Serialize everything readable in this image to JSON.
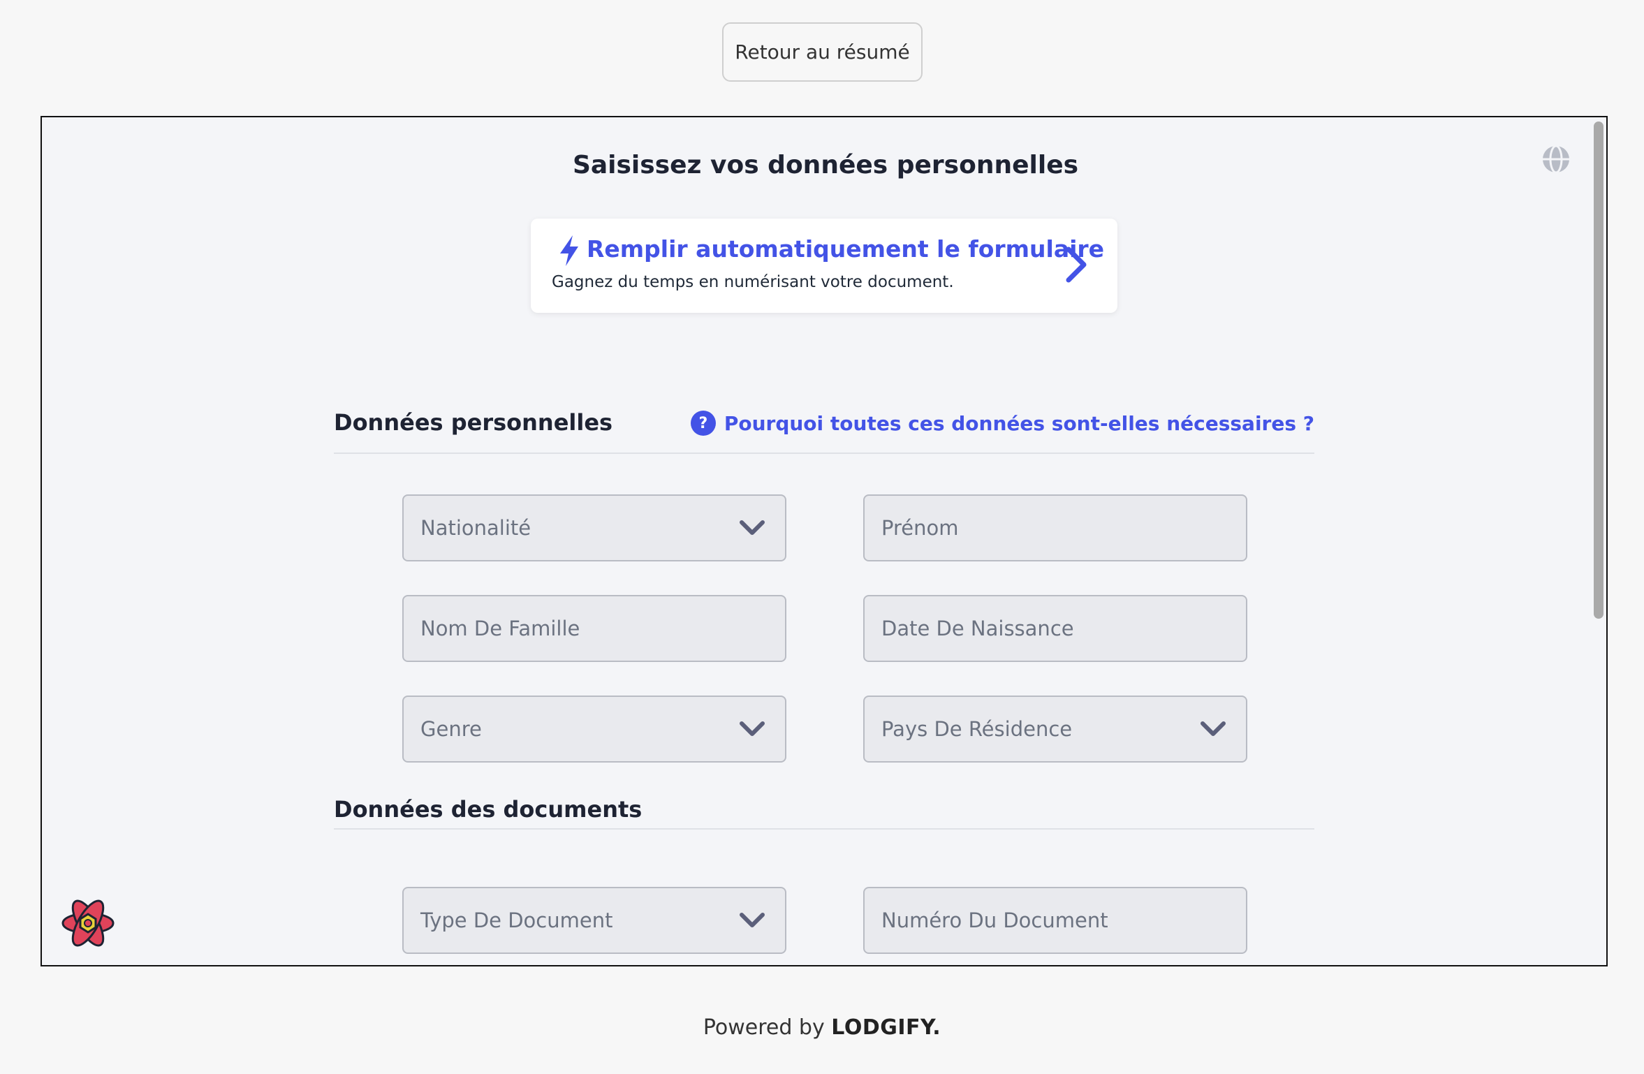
{
  "back_button": {
    "label": "Retour au résumé"
  },
  "form": {
    "title": "Saisissez vos données personnelles",
    "globe_icon": "globe-icon",
    "autofill": {
      "title": "Remplir automatiquement le formulaire",
      "subtitle": "Gagnez du temps en numérisant votre document.",
      "icon": "lightning-icon",
      "arrow_icon": "chevron-right-icon"
    },
    "personal_section": {
      "title": "Données personnelles",
      "help_link": "Pourquoi toutes ces données sont-elles nécessaires ?",
      "fields": {
        "nationality": "Nationalité",
        "first_name": "Prénom",
        "last_name": "Nom De Famille",
        "birth_date": "Date De Naissance",
        "gender": "Genre",
        "residence_country": "Pays De Résidence"
      }
    },
    "documents_section": {
      "title": "Données des documents",
      "fields": {
        "document_type": "Type De Document",
        "document_number": "Numéro Du Document"
      }
    }
  },
  "footer": {
    "powered_prefix": "Powered by",
    "brand": "LODGIFY."
  },
  "colors": {
    "accent": "#4353e6",
    "field_bg": "#e9eaee",
    "frame_bg": "#f4f5f8"
  }
}
